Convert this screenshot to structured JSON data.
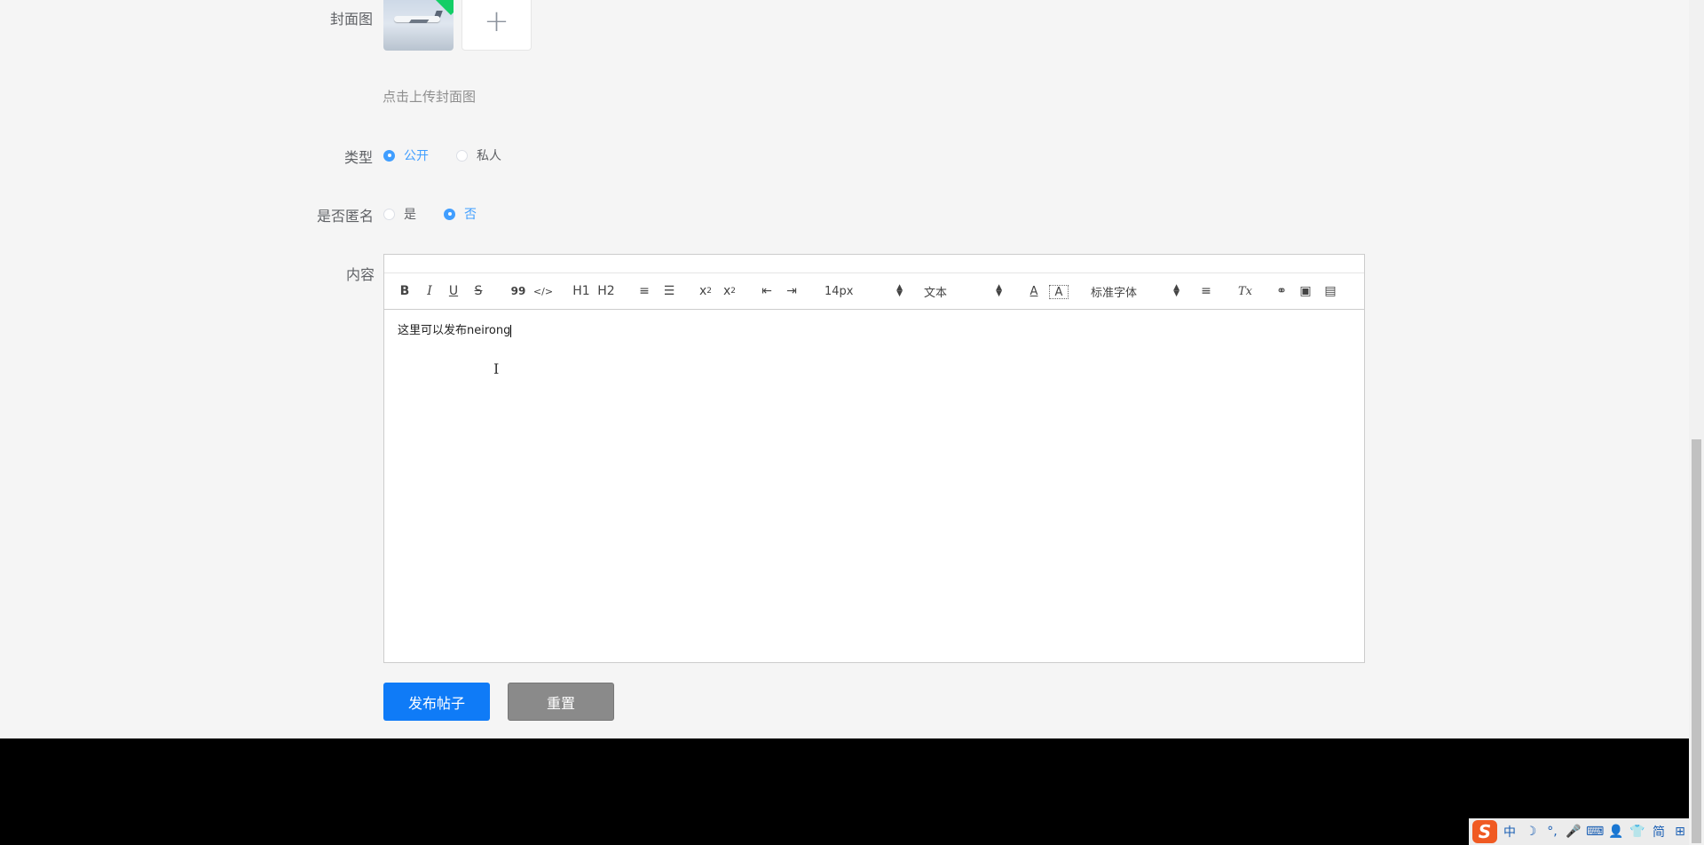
{
  "form": {
    "cover_label": "封面图",
    "cover_hint": "点击上传封面图",
    "type_label": "类型",
    "type_options": [
      "公开",
      "私人"
    ],
    "anonymous_label": "是否匿名",
    "anonymous_options": [
      "是",
      "否"
    ],
    "content_label": "内容"
  },
  "editor": {
    "toolbar": {
      "bold": "B",
      "italic": "I",
      "underline": "U",
      "strike": "S",
      "quote": "99",
      "code": "</>",
      "h1": "H1",
      "h2": "H2",
      "ordered_list": "≡",
      "bullet_list": "☰",
      "subscript": "x",
      "superscript": "x",
      "indent_decrease": "⇤",
      "indent_increase": "⇥",
      "font_size": "14px",
      "header": "文本",
      "font_family": "标准字体",
      "align": "≡",
      "clean": "Tx",
      "link": "🔗",
      "image": "▣",
      "video": "▤"
    },
    "content": "这里可以发布neirong"
  },
  "buttons": {
    "submit": "发布帖子",
    "reset": "重置"
  },
  "ime": {
    "logo": "S",
    "items": [
      "中",
      "☽",
      "°,",
      "🎤",
      "⌨",
      "👤",
      "👕",
      "简",
      "⊞"
    ]
  }
}
